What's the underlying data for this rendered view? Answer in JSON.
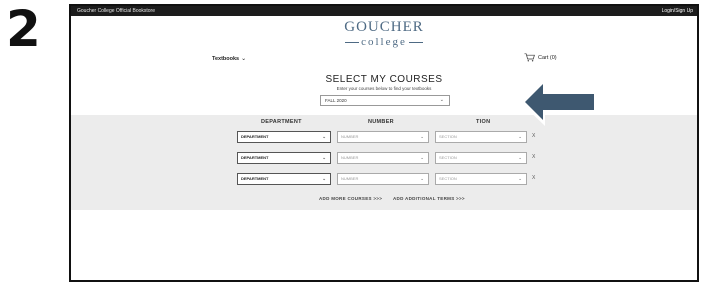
{
  "step_number": "2",
  "topbar": {
    "store_name": "Goucher College Official Bookstore",
    "login": "Login/Sign Up"
  },
  "logo": {
    "line1": "GOUCHER",
    "line2": "college"
  },
  "nav": {
    "textbooks": "Textbooks",
    "cart": "Cart (0)"
  },
  "select_courses": {
    "heading": "SELECT MY COURSES",
    "subheading": "Enter your courses below to find your textbooks",
    "term_value": "FALL 2020"
  },
  "columns": {
    "department": "DEPARTMENT",
    "number": "NUMBER",
    "section": "TION"
  },
  "rows": [
    {
      "department": "DEPARTMENT",
      "number": "NUMBER",
      "section": "SECTION",
      "remove": "X"
    },
    {
      "department": "DEPARTMENT",
      "number": "NUMBER",
      "section": "SECTION",
      "remove": "X"
    },
    {
      "department": "DEPARTMENT",
      "number": "NUMBER",
      "section": "SECTION",
      "remove": "X"
    }
  ],
  "links": {
    "add_courses": "ADD MORE COURSES >>>",
    "add_terms": "ADD ADDITIONAL TERMS >>>"
  },
  "icons": {
    "chevron": "chevron-down-icon",
    "cart": "cart-icon",
    "arrow": "left-arrow-callout-icon"
  },
  "colors": {
    "logo": "#4e6a84",
    "panel": "#ececec",
    "arrow_fill": "#3e5870"
  }
}
